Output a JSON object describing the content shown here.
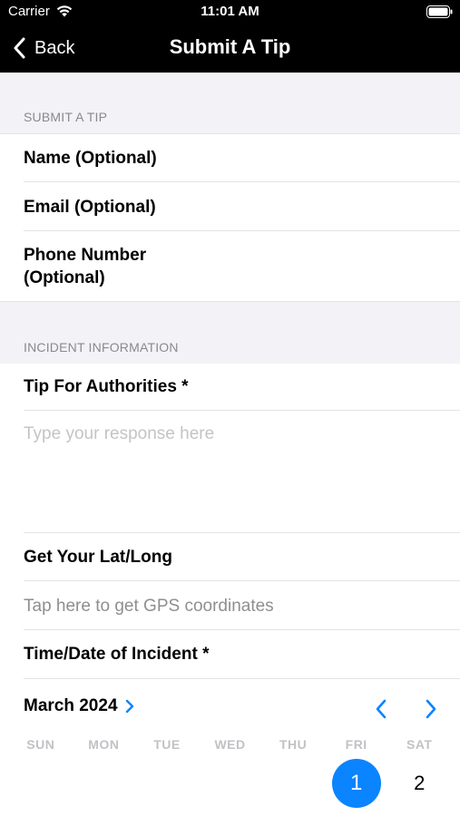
{
  "status_bar": {
    "carrier": "Carrier",
    "time": "11:01 AM"
  },
  "nav": {
    "back_label": "Back",
    "title": "Submit A Tip"
  },
  "sections": {
    "submit": {
      "header": "SUBMIT A TIP",
      "fields": {
        "name": "Name (Optional)",
        "email": "Email (Optional)",
        "phone_line1": "Phone Number",
        "phone_line2": "(Optional)"
      }
    },
    "incident": {
      "header": "INCIDENT INFORMATION",
      "tip_label": "Tip For Authorities *",
      "tip_placeholder": "Type your response here",
      "latlong_label": "Get Your Lat/Long",
      "latlong_placeholder": "Tap here to get GPS coordinates",
      "time_label": "Time/Date of Incident *"
    }
  },
  "calendar": {
    "month_label": "March 2024",
    "weekdays": [
      "SUN",
      "MON",
      "TUE",
      "WED",
      "THU",
      "FRI",
      "SAT"
    ],
    "first_row": [
      "",
      "",
      "",
      "",
      "",
      "1",
      "2"
    ],
    "selected_day": "1"
  },
  "colors": {
    "accent": "#0a84ff",
    "nav_background": "#000000",
    "section_background": "#f2f2f7"
  }
}
